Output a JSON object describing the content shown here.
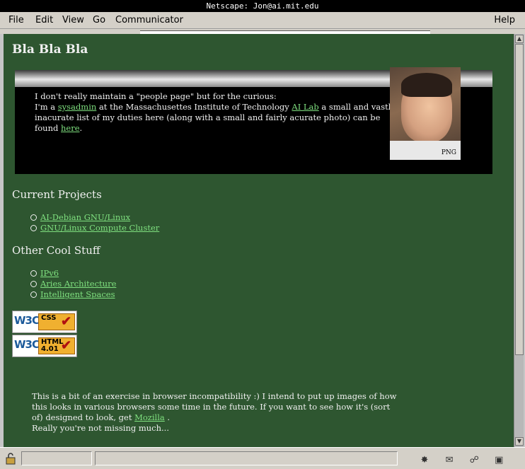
{
  "window": {
    "title": "Netscape: Jon@ai.mit.edu"
  },
  "menu": {
    "file": "File",
    "edit": "Edit",
    "view": "View",
    "go": "Go",
    "communicator": "Communicator",
    "help": "Help"
  },
  "page": {
    "title": "Bla Bla Bla",
    "intro": {
      "line1": "I don't really maintain a \"people page\" but for the curious:",
      "pre_sysadmin": "I'm a ",
      "sysadmin": "sysadmin",
      "mid": " at the Massachusettes Institute of Technology ",
      "ailab": "AI Lab",
      "post": " a small and vastly inacurate list of my duties here (along with a small and fairly acurate photo) can be found ",
      "here": "here",
      "end": "."
    },
    "photo_label": "PNG",
    "current_projects": {
      "heading": "Current Projects",
      "items": [
        "AI-Debian GNU/Linux",
        "GNU/Linux Compute Cluster"
      ]
    },
    "other_stuff": {
      "heading": "Other Cool Stuff",
      "items": [
        "IPv6",
        "Aries Architecture",
        "Intelligent Spaces"
      ]
    },
    "badges": {
      "css": {
        "w3c": "W3C",
        "label": "CSS"
      },
      "html": {
        "w3c": "W3C",
        "label1": "HTML",
        "label2": "4.01"
      }
    },
    "footer": {
      "text": "This is a bit of an exercise in browser incompatibility :) I intend to put up images of how this looks in various browsers some time in the future. If you want to see how it's (sort of) designed to look, get ",
      "mozilla": "Mozilla",
      "end": " .",
      "line2": "Really you're not missing much..."
    }
  },
  "colors": {
    "background": "#2e5630",
    "link": "#7fe07f",
    "text": "#f0f0f0"
  }
}
